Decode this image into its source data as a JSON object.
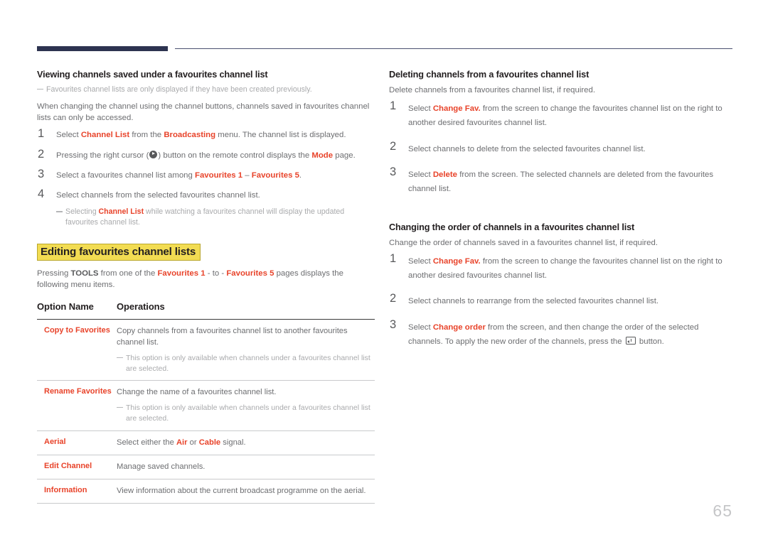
{
  "document": {
    "page_number": "65",
    "accent_color": "#e8432a",
    "header_bar_color": "#2d3350",
    "highlight_color": "#f2dc52"
  },
  "left_column": {
    "section1": {
      "title": "Viewing channels saved under a favourites channel list",
      "note": "Favourites channel lists are only displayed if they have been created previously.",
      "intro": "When changing the channel using the channel buttons, channels saved in favourites channel lists can only be accessed.",
      "steps": [
        {
          "num": "1",
          "parts": [
            {
              "t": "Select ",
              "s": "plain"
            },
            {
              "t": "Channel List",
              "s": "accent"
            },
            {
              "t": " from the ",
              "s": "plain"
            },
            {
              "t": "Broadcasting",
              "s": "accent"
            },
            {
              "t": " menu. The channel list is displayed.",
              "s": "plain"
            }
          ]
        },
        {
          "num": "2",
          "parts": [
            {
              "t": "Pressing the right cursor (",
              "s": "plain"
            },
            {
              "t": "",
              "s": "icon-cursor-right"
            },
            {
              "t": ") button on the remote control displays the ",
              "s": "plain"
            },
            {
              "t": "Mode",
              "s": "accent"
            },
            {
              "t": " page.",
              "s": "plain"
            }
          ]
        },
        {
          "num": "3",
          "parts": [
            {
              "t": "Select a favourites channel list among ",
              "s": "plain"
            },
            {
              "t": "Favourites 1",
              "s": "accent"
            },
            {
              "t": " – ",
              "s": "plain"
            },
            {
              "t": "Favourites 5",
              "s": "accent"
            },
            {
              "t": ".",
              "s": "plain"
            }
          ]
        },
        {
          "num": "4",
          "parts": [
            {
              "t": "Select channels from the selected favourites channel list.",
              "s": "plain"
            }
          ]
        }
      ],
      "step_note_parts": [
        {
          "t": "Selecting ",
          "s": "plain"
        },
        {
          "t": "Channel List",
          "s": "accent"
        },
        {
          "t": " while watching a favourites channel will display the updated favourites channel list.",
          "s": "plain"
        }
      ]
    },
    "section2": {
      "title": "Editing favourites channel lists",
      "intro_parts": [
        {
          "t": "Pressing ",
          "s": "plain"
        },
        {
          "t": "TOOLS",
          "s": "strong"
        },
        {
          "t": " from one of the ",
          "s": "plain"
        },
        {
          "t": "Favourites 1",
          "s": "accent"
        },
        {
          "t": " - to - ",
          "s": "plain"
        },
        {
          "t": "Favourites 5",
          "s": "accent"
        },
        {
          "t": " pages displays the following menu items.",
          "s": "plain"
        }
      ],
      "table": {
        "headers": [
          "Option Name",
          "Operations"
        ],
        "rows": [
          {
            "name": "Copy to Favorites",
            "operation": "Copy channels from a favourites channel list to another favourites channel list.",
            "note": "This option is only available when channels under a favourites channel list are selected."
          },
          {
            "name": "Rename Favorites",
            "operation": "Change the name of a favourites channel list.",
            "note": "This option is only available when channels under a favourites channel list are selected."
          },
          {
            "name": "Aerial",
            "operation_parts": [
              {
                "t": "Select either the ",
                "s": "plain"
              },
              {
                "t": "Air",
                "s": "accent"
              },
              {
                "t": " or ",
                "s": "plain"
              },
              {
                "t": "Cable",
                "s": "accent"
              },
              {
                "t": " signal.",
                "s": "plain"
              }
            ],
            "note": ""
          },
          {
            "name": "Edit Channel",
            "operation": "Manage saved channels.",
            "note": ""
          },
          {
            "name": "Information",
            "operation": "View information about the current broadcast programme on the aerial.",
            "note": ""
          }
        ]
      }
    }
  },
  "right_column": {
    "section1": {
      "title": "Deleting channels from a favourites channel list",
      "intro": "Delete channels from a favourites channel list, if required.",
      "steps": [
        {
          "num": "1",
          "parts": [
            {
              "t": "Select ",
              "s": "plain"
            },
            {
              "t": "Change Fav.",
              "s": "accent"
            },
            {
              "t": " from the screen to change the favourites channel list on the right to another desired favourites channel list.",
              "s": "plain"
            }
          ]
        },
        {
          "num": "2",
          "parts": [
            {
              "t": "Select channels to delete from the selected favourites channel list.",
              "s": "plain"
            }
          ]
        },
        {
          "num": "3",
          "parts": [
            {
              "t": "Select ",
              "s": "plain"
            },
            {
              "t": "Delete",
              "s": "accent"
            },
            {
              "t": " from the screen. The selected channels are deleted from the favourites channel list.",
              "s": "plain"
            }
          ]
        }
      ]
    },
    "section2": {
      "title": "Changing the order of channels in a favourites channel list",
      "intro": "Change the order of channels saved in a favourites channel list, if required.",
      "steps": [
        {
          "num": "1",
          "parts": [
            {
              "t": "Select ",
              "s": "plain"
            },
            {
              "t": "Change Fav.",
              "s": "accent"
            },
            {
              "t": " from the screen to change the favourites channel list on the right to another desired favourites channel list.",
              "s": "plain"
            }
          ]
        },
        {
          "num": "2",
          "parts": [
            {
              "t": "Select channels to rearrange from the selected favourites channel list.",
              "s": "plain"
            }
          ]
        },
        {
          "num": "3",
          "parts": [
            {
              "t": "Select ",
              "s": "plain"
            },
            {
              "t": "Change order",
              "s": "accent"
            },
            {
              "t": " from the screen, and then change the order of the selected channels. To apply the new order of the channels, press the ",
              "s": "plain"
            },
            {
              "t": "",
              "s": "icon-enter"
            },
            {
              "t": " button.",
              "s": "plain"
            }
          ]
        }
      ]
    }
  }
}
